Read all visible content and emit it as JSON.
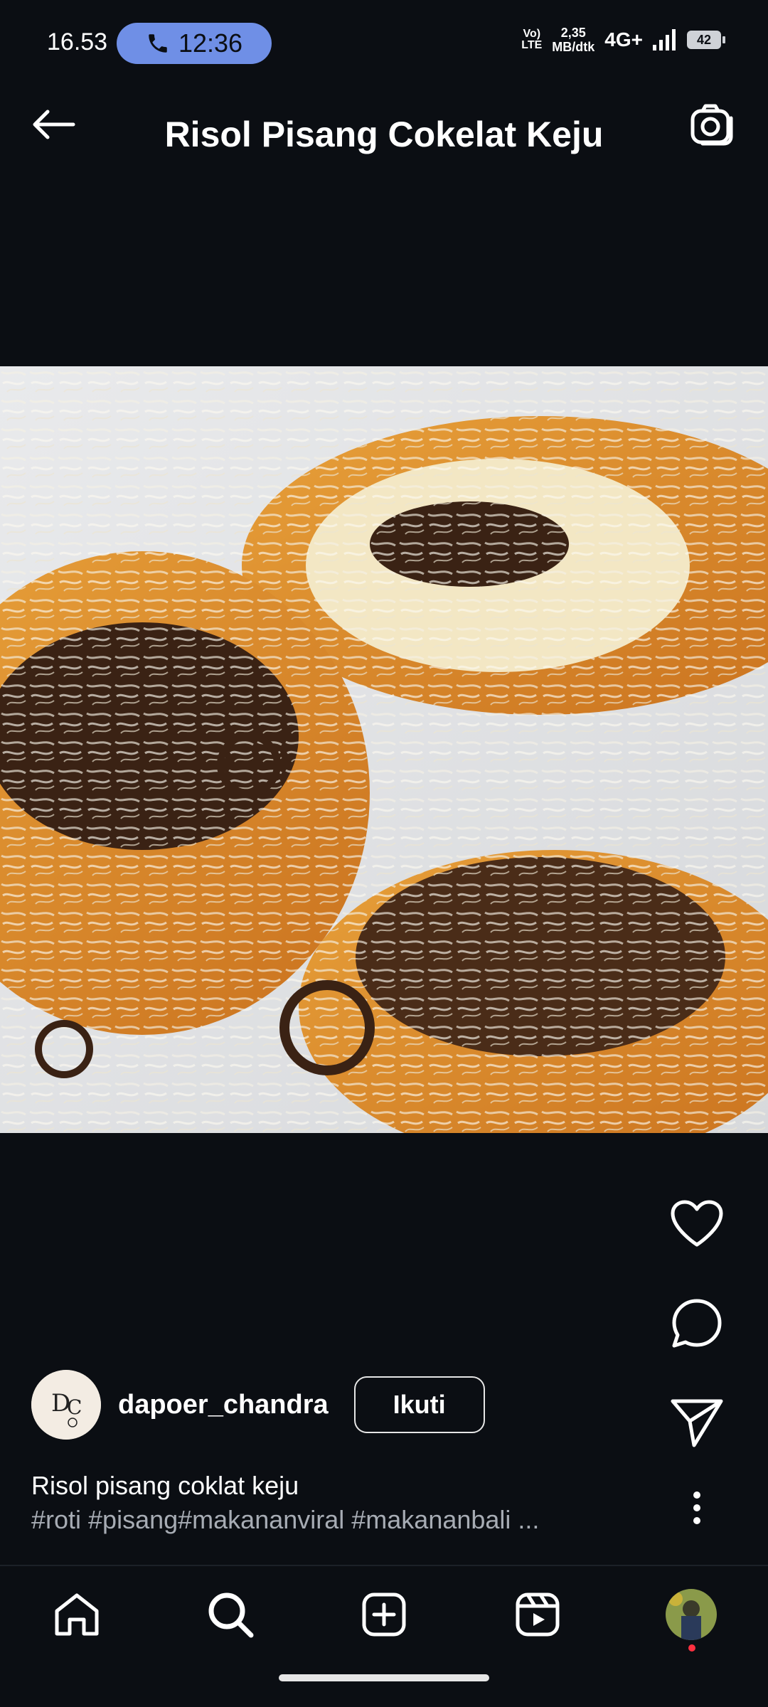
{
  "status_bar": {
    "time": "16.53",
    "call_timer": "12:36",
    "volte_top": "Vo)",
    "volte_bottom": "LTE",
    "data_rate_value": "2,35",
    "data_rate_unit": "MB/dtk",
    "network": "4G+",
    "battery_level": "42",
    "call_pill_color": "#6f8fe6"
  },
  "header": {
    "title": "Risol Pisang Cokelat Keju",
    "back_icon": "arrow-left-icon",
    "camera_icon": "camera-icon"
  },
  "media": {
    "image_icon": "food-photo"
  },
  "actions": {
    "like_icon": "heart-icon",
    "comment_icon": "comment-bubble-icon",
    "share_icon": "send-icon",
    "more_icon": "more-vertical-icon"
  },
  "post": {
    "username": "dapoer_chandra",
    "follow_label": "Ikuti",
    "caption_line1": "Risol pisang coklat keju",
    "caption_line2": "#roti #pisang#makananviral #makananbali ..."
  },
  "bottom_nav": {
    "items": [
      "home-icon",
      "search-icon",
      "create-icon",
      "reels-icon",
      "profile-avatar"
    ]
  },
  "colors": {
    "background": "#0b0e13",
    "text": "#ffffff",
    "muted_text": "#a7acb4",
    "notification_dot": "#ff3040"
  }
}
